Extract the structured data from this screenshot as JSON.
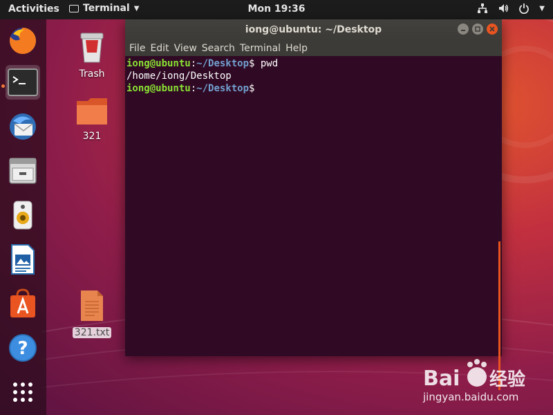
{
  "topbar": {
    "activities": "Activities",
    "app_name": "Terminal",
    "clock": "Mon 19:36",
    "status_icons": [
      "network-icon",
      "volume-icon",
      "power-icon"
    ]
  },
  "dock": {
    "items": [
      "firefox",
      "terminal",
      "thunderbird",
      "files",
      "rhythmbox",
      "libreoffice-writer",
      "ubuntu-software",
      "help",
      "show-applications"
    ],
    "active": "terminal"
  },
  "desktop": {
    "icons": [
      {
        "label": "Trash"
      },
      {
        "label": "321"
      },
      {
        "label": "321.txt",
        "selected": true
      }
    ]
  },
  "terminal": {
    "title": "iong@ubuntu: ~/Desktop",
    "menu": [
      "File",
      "Edit",
      "View",
      "Search",
      "Terminal",
      "Help"
    ],
    "lines": [
      {
        "user": "iong@ubuntu",
        "path": "~/Desktop",
        "cmd": "pwd"
      },
      {
        "output": "/home/iong/Desktop"
      },
      {
        "user": "iong@ubuntu",
        "path": "~/Desktop",
        "cmd": ""
      }
    ]
  },
  "watermark": {
    "url": "jingyan.baidu.com"
  },
  "colors": {
    "accent": "#e95420",
    "terminal_bg": "#300a24",
    "prompt_user": "#8ae234",
    "prompt_path": "#729fcf"
  }
}
